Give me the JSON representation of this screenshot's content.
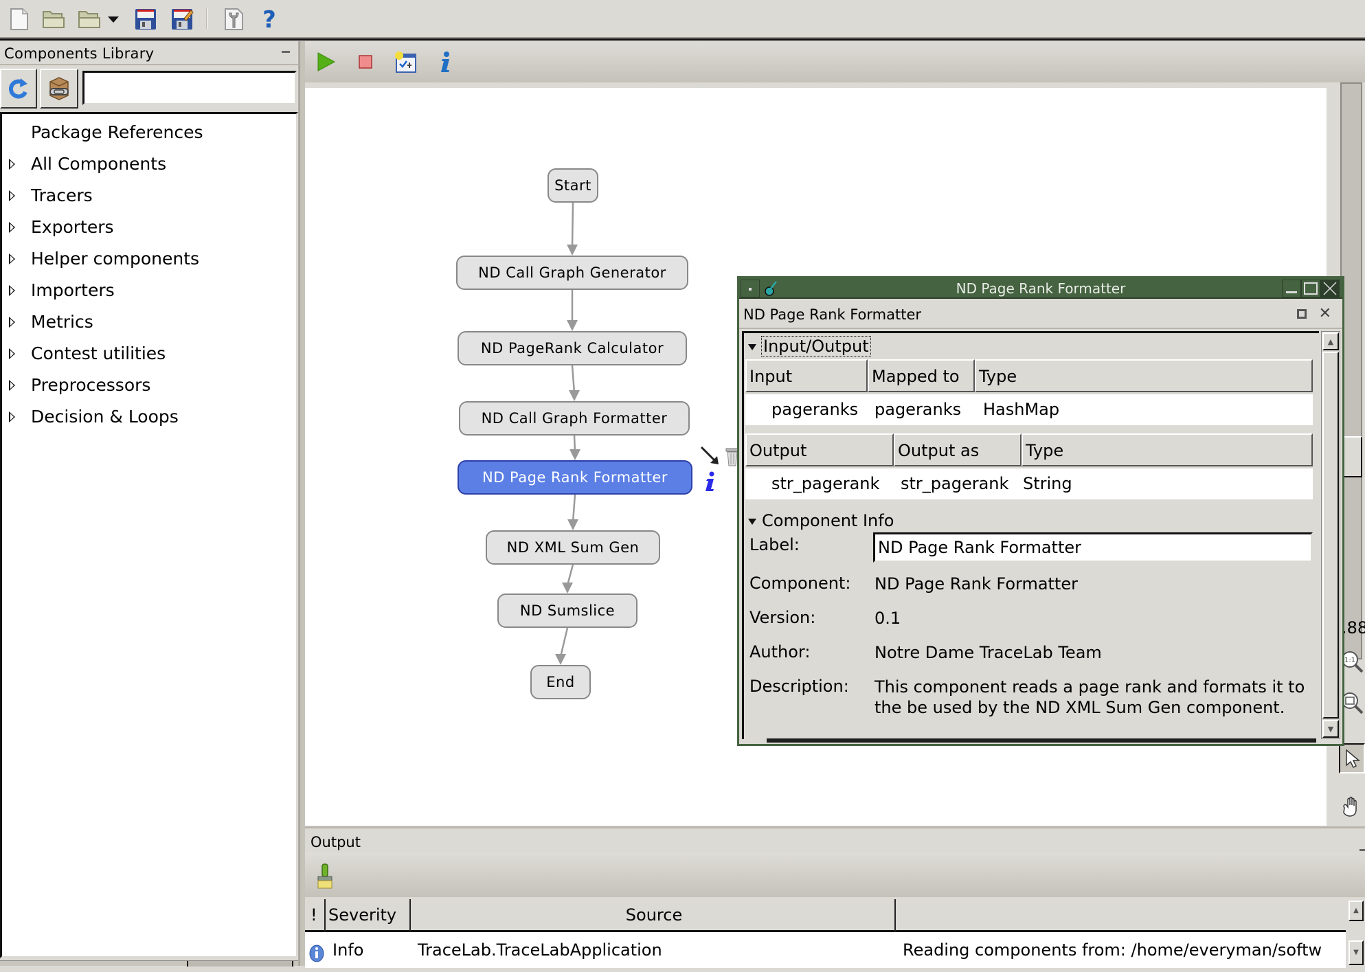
{
  "main_toolbar": {
    "icons": [
      "new-file-icon",
      "open-folder-icon",
      "open-recent-folder-icon",
      "dropdown-arrow-icon",
      "save-icon",
      "save-as-icon",
      "settings-wrench-icon",
      "help-icon"
    ]
  },
  "library": {
    "title": "Components Library",
    "search_value": "",
    "tree": [
      {
        "label": "Package References",
        "expandable": false
      },
      {
        "label": "All Components",
        "expandable": true
      },
      {
        "label": "Tracers",
        "expandable": true
      },
      {
        "label": "Exporters",
        "expandable": true
      },
      {
        "label": "Helper components",
        "expandable": true
      },
      {
        "label": "Importers",
        "expandable": true
      },
      {
        "label": "Metrics",
        "expandable": true
      },
      {
        "label": "Contest utilities",
        "expandable": true
      },
      {
        "label": "Preprocessors",
        "expandable": true
      },
      {
        "label": "Decision & Loops",
        "expandable": true
      }
    ]
  },
  "canvas_toolbar": {
    "icons": [
      "run-icon",
      "stop-icon",
      "new-benchmark-icon",
      "info-icon"
    ]
  },
  "graph": {
    "nodes": [
      {
        "id": "start",
        "label": "Start",
        "selected": false
      },
      {
        "id": "cgg",
        "label": "ND Call Graph Generator",
        "selected": false
      },
      {
        "id": "prc",
        "label": "ND PageRank Calculator",
        "selected": false
      },
      {
        "id": "cgf",
        "label": "ND Call Graph Formatter",
        "selected": false
      },
      {
        "id": "prf",
        "label": "ND Page Rank Formatter",
        "selected": true
      },
      {
        "id": "xml",
        "label": "ND XML Sum Gen",
        "selected": false
      },
      {
        "id": "sum",
        "label": "ND Sumslice",
        "selected": false
      },
      {
        "id": "end",
        "label": "End",
        "selected": false
      }
    ],
    "edges": [
      [
        "start",
        "cgg"
      ],
      [
        "cgg",
        "prc"
      ],
      [
        "prc",
        "cgf"
      ],
      [
        "cgf",
        "prf"
      ],
      [
        "prf",
        "xml"
      ],
      [
        "xml",
        "sum"
      ],
      [
        "sum",
        "end"
      ]
    ],
    "selected_node_actions": [
      "connect-arrow-icon",
      "delete-icon",
      "info-icon"
    ],
    "zoom_readout": ".88"
  },
  "dialog": {
    "window_title": "ND Page Rank Formatter",
    "subtitle": "ND Page Rank Formatter",
    "io_section": "Input/Output",
    "inputs": {
      "headers": [
        "Input",
        "Mapped to",
        "Type"
      ],
      "rows": [
        [
          "pageranks",
          "pageranks",
          "HashMap"
        ]
      ]
    },
    "outputs": {
      "headers": [
        "Output",
        "Output as",
        "Type"
      ],
      "rows": [
        [
          "str_pagerank",
          "str_pagerank",
          "String"
        ]
      ]
    },
    "info_section": "Component Info",
    "label_label": "Label:",
    "label_value": "ND Page Rank Formatter",
    "component_label": "Component:",
    "component_value": "ND Page Rank Formatter",
    "version_label": "Version:",
    "version_value": "0.1",
    "author_label": "Author:",
    "author_value": "Notre Dame TraceLab Team",
    "description_label": "Description:",
    "description_value": "This component reads a page rank and formats it to the be used by the ND XML Sum Gen component."
  },
  "output": {
    "title": "Output",
    "headers": [
      "!",
      "Severity",
      "Source",
      ""
    ],
    "rows": [
      {
        "severity": "Info",
        "source": "TraceLab.TraceLabApplication",
        "message": "Reading components from: /home/everyman/softw"
      }
    ]
  }
}
